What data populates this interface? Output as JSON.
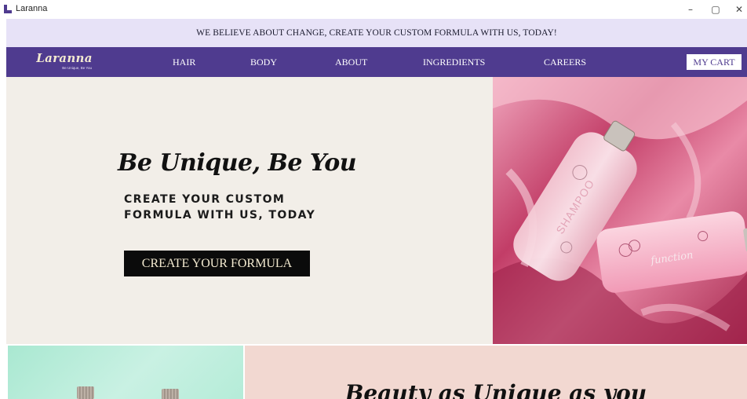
{
  "window": {
    "title": "Laranna",
    "icon": "laranna-app-icon",
    "controls": {
      "minimize": "–",
      "maximize": "▢",
      "close": "✕"
    }
  },
  "announcement": {
    "text": "WE BELIEVE ABOUT CHANGE, CREATE YOUR CUSTOM FORMULA WITH US, TODAY!"
  },
  "nav": {
    "brand": {
      "name": "Laranna",
      "tagline": "Be Unique, Be You"
    },
    "links": [
      "HAIR",
      "BODY",
      "ABOUT",
      "INGREDIENTS",
      "CAREERS"
    ],
    "cart_label": "MY CART"
  },
  "hero": {
    "title": "Be Unique, Be You",
    "subtitle_line1": "CREATE YOUR CUSTOM",
    "subtitle_line2": "FORMULA WITH US, TODAY",
    "cta_label": "CREATE YOUR FORMULA",
    "image": {
      "bottle1_label": "SHAMPOO",
      "bottle2_label": "function"
    }
  },
  "section": {
    "title": "Beauty as Unique as you"
  },
  "colors": {
    "accent_purple": "#4f3b8f",
    "announce_bg": "#e7e2f7",
    "hero_bg": "#f2eee8",
    "cta_bg": "#0b0b0b",
    "cta_text": "#f3ead0",
    "mint": "#a9e8d1",
    "blush": "#f2d8d1"
  }
}
